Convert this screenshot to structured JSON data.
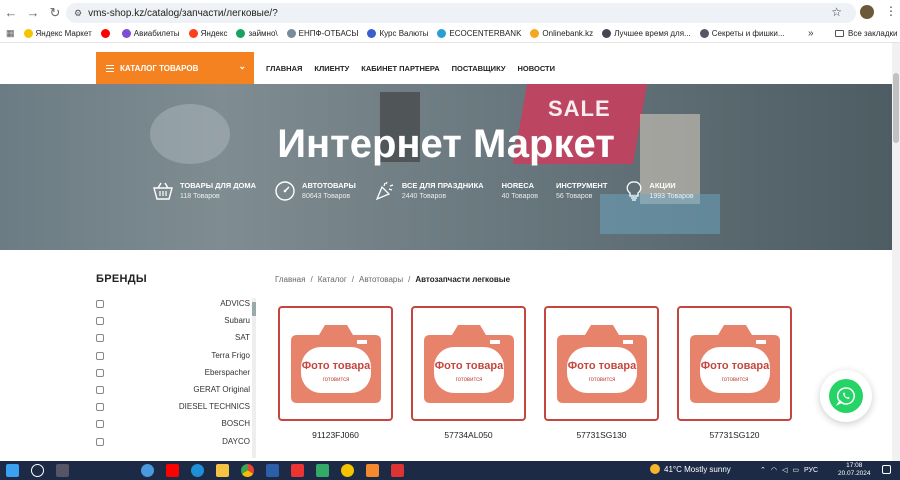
{
  "browser": {
    "url": "vms-shop.kz/catalog/запчасти/легковые/?",
    "bookmarks": [
      {
        "label": "Яндекс Маркет",
        "color": "#f5c400"
      },
      {
        "label": "",
        "color": "#ff0000"
      },
      {
        "label": "Авиабилеты",
        "color": "#7d4dd6"
      },
      {
        "label": "Яндекс",
        "color": "#fc3f1d"
      },
      {
        "label": "займно\\",
        "color": "#1aa360"
      },
      {
        "label": "ЕНПФ-ОТБАСЫ",
        "color": "#7a8a9a"
      },
      {
        "label": "Курс Валюты",
        "color": "#3a5fcd"
      },
      {
        "label": "ECOCENTERBANK",
        "color": "#2a9fd6"
      },
      {
        "label": "Onlinebank.kz",
        "color": "#f5a623"
      },
      {
        "label": "Лучшее время для...",
        "color": "#445"
      },
      {
        "label": "Секреты и фишки...",
        "color": "#556"
      }
    ],
    "bookmarks_more": "»",
    "all_bookmarks": "Все закладки"
  },
  "header": {
    "catalog_label": "КАТАЛОГ ТОВАРОВ",
    "nav": [
      "ГЛАВНАЯ",
      "КЛИЕНТУ",
      "КАБИНЕТ ПАРТНЕРА",
      "ПОСТАВЩИКУ",
      "НОВОСТИ"
    ]
  },
  "hero": {
    "title": "Интернет Маркет",
    "sale_text": "SALE",
    "categories": [
      {
        "title": "ТОВАРЫ ДЛЯ ДОМА",
        "count": "118 Товаров",
        "icon": "basket-icon"
      },
      {
        "title": "АВТОТОВАРЫ",
        "count": "80643 Товаров",
        "icon": "speedometer-icon"
      },
      {
        "title": "ВСЕ ДЛЯ ПРАЗДНИКА",
        "count": "2440 Товаров",
        "icon": "party-icon"
      },
      {
        "title": "HORECA",
        "count": "40 Товаров",
        "icon": "none"
      },
      {
        "title": "ИНСТРУМЕНТ",
        "count": "56 Товаров",
        "icon": "none"
      },
      {
        "title": "АКЦИИ",
        "count": "1993 Товаров",
        "icon": "lightbulb-icon"
      }
    ]
  },
  "brands": {
    "title": "БРЕНДЫ",
    "items": [
      "ADVICS",
      "Subaru",
      "SAT",
      "Terra Frigo",
      "Eberspacher",
      "GERAT Original",
      "DIESEL TECHNICS",
      "BOSCH",
      "DAYCO"
    ]
  },
  "breadcrumb": [
    "Главная",
    "Каталог",
    "Автотовары",
    "Автозапчасти легковые"
  ],
  "products": [
    {
      "sku": "91123FJ060",
      "photo_text": "Фото товара",
      "photo_sub": "готовится"
    },
    {
      "sku": "57734AL050",
      "photo_text": "Фото товара",
      "photo_sub": "готовится"
    },
    {
      "sku": "57731SG130",
      "photo_text": "Фото товара",
      "photo_sub": "готовится"
    },
    {
      "sku": "57731SG120",
      "photo_text": "Фото товара",
      "photo_sub": "готовится"
    }
  ],
  "taskbar": {
    "weather": "41°C  Mostly sunny",
    "lang": "РУС",
    "time": "17:08",
    "date": "20.07.2024"
  },
  "colors": {
    "accent": "#f58220",
    "placeholder": "#e8836b",
    "placeholder_border": "#c5463f",
    "whatsapp": "#25d366"
  }
}
